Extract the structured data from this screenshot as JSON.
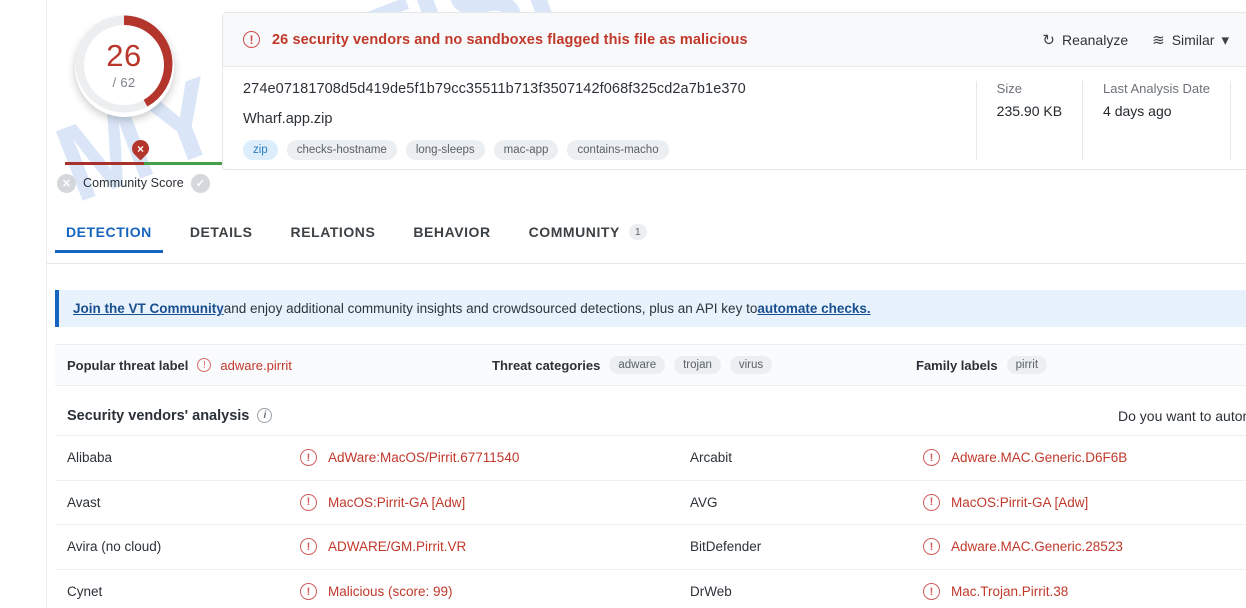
{
  "watermark": {
    "text": "MYANTISPYWARE.COM"
  },
  "score": {
    "detections": "26",
    "total": "/ 62",
    "detections_num": 26,
    "total_num": 62,
    "community_label": "Community Score",
    "negative_icon": "x-circle-icon",
    "positive_icon": "check-circle-icon",
    "arc_color": "#b3352c",
    "track_color": "#e8eaec"
  },
  "alert": {
    "icon": "exclamation-circle-icon",
    "text": "26 security vendors and no sandboxes flagged this file as malicious",
    "color": "#c0392b",
    "actions": [
      {
        "label": "Reanalyze",
        "icon": "refresh-icon",
        "glyph": "↻"
      },
      {
        "label": "Similar",
        "icon": "similar-icon",
        "glyph": "≋",
        "caret": "▾"
      }
    ]
  },
  "file": {
    "hash": "274e07181708d5d419de5f1b79cc35511b713f3507142f068f325cd2a7b1e370",
    "name": "Wharf.app.zip",
    "tags": [
      {
        "label": "zip",
        "style": "blue"
      },
      {
        "label": "checks-hostname",
        "style": "gray"
      },
      {
        "label": "long-sleeps",
        "style": "gray"
      },
      {
        "label": "mac-app",
        "style": "gray"
      },
      {
        "label": "contains-macho",
        "style": "gray"
      }
    ],
    "meta": [
      {
        "key": "Size",
        "value": "235.90 KB"
      },
      {
        "key": "Last Analysis Date",
        "value": "4 days ago"
      }
    ]
  },
  "tabs": [
    {
      "label": "DETECTION",
      "active": true,
      "badge": ""
    },
    {
      "label": "DETAILS",
      "active": false,
      "badge": ""
    },
    {
      "label": "RELATIONS",
      "active": false,
      "badge": ""
    },
    {
      "label": "BEHAVIOR",
      "active": false,
      "badge": ""
    },
    {
      "label": "COMMUNITY",
      "active": false,
      "badge": "1"
    }
  ],
  "banner": {
    "link1": "Join the VT Community",
    "middle": " and enjoy additional community insights and crowdsourced detections, plus an API key to ",
    "link2": "automate checks."
  },
  "threat": {
    "popular_key": "Popular threat label",
    "popular_value": "adware.pirrit",
    "categories_key": "Threat categories",
    "categories": [
      "adware",
      "trojan",
      "virus"
    ],
    "family_key": "Family labels",
    "families": [
      "pirrit"
    ]
  },
  "vendors_section": {
    "title": "Security vendors' analysis",
    "info_icon": "info-icon",
    "right_text": "Do you want to autom"
  },
  "vendors": [
    {
      "left_name": "Alibaba",
      "left_result": "AdWare:MacOS/Pirrit.67711540",
      "right_name": "Arcabit",
      "right_result": "Adware.MAC.Generic.D6F6B"
    },
    {
      "left_name": "Avast",
      "left_result": "MacOS:Pirrit-GA [Adw]",
      "right_name": "AVG",
      "right_result": "MacOS:Pirrit-GA [Adw]"
    },
    {
      "left_name": "Avira (no cloud)",
      "left_result": "ADWARE/GM.Pirrit.VR",
      "right_name": "BitDefender",
      "right_result": "Adware.MAC.Generic.28523"
    },
    {
      "left_name": "Cynet",
      "left_result": "Malicious (score: 99)",
      "right_name": "DrWeb",
      "right_result": "Mac.Trojan.Pirrit.38"
    }
  ]
}
